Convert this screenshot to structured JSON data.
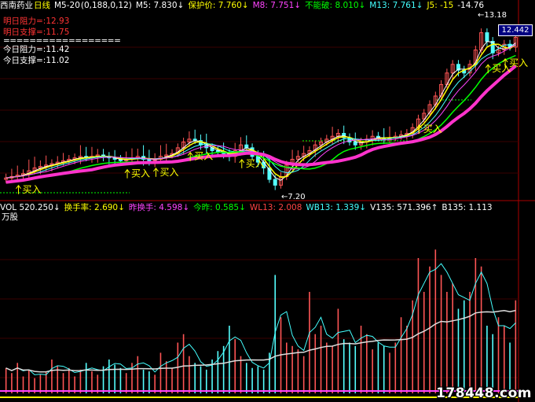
{
  "header": {
    "name": "西南药业",
    "period": "日线",
    "indicator": "M5-20",
    "params": "(0,188,0,12)",
    "items": [
      {
        "label": "M5:",
        "value": "7.830↓",
        "color": "#ffffff"
      },
      {
        "label": "保护价:",
        "value": "7.760↓",
        "color": "#ffff00"
      },
      {
        "label": "M8:",
        "value": "7.751↓",
        "color": "#ff44ff"
      },
      {
        "label": "不能破:",
        "value": "8.010↓",
        "color": "#00ff00"
      },
      {
        "label": "M13:",
        "value": "7.761↓",
        "color": "#44ffff"
      },
      {
        "label": "J5:",
        "value": "-15",
        "color": "#ffff00"
      },
      {
        "label": "",
        "value": "-14.76",
        "color": "#ffffff"
      }
    ]
  },
  "levels": {
    "tomorrow_resist": "明日阻力=:12.93",
    "tomorrow_support": "明日支撑=:11.75",
    "separator": "==================",
    "today_resist": "今日阻力=:11.42",
    "today_support": "今日支撑=:11.02"
  },
  "volume_header": {
    "items": [
      {
        "label": "VOL",
        "value": "520.250↓",
        "color": "#ffffff"
      },
      {
        "label": "换手率:",
        "value": "2.690↓",
        "color": "#ffff00"
      },
      {
        "label": "昨换手:",
        "value": "4.598↓",
        "color": "#ff44ff"
      },
      {
        "label": "今昨:",
        "value": "0.585↓",
        "color": "#00ff00"
      },
      {
        "label": "WL13:",
        "value": "2.008",
        "color": "#ff4444"
      },
      {
        "label": "WB13:",
        "value": "1.339↓",
        "color": "#44ffff"
      },
      {
        "label": "V135:",
        "value": "571.396↑",
        "color": "#ffffff"
      },
      {
        "label": "B135:",
        "value": "1.113",
        "color": "#ffffff"
      }
    ],
    "unit": "万股"
  },
  "price_tag": "12.442",
  "watermark": "178448.com",
  "chart_data": {
    "type": "candlestick",
    "high_label": "13.18",
    "low_label": "7.20",
    "buy_label": "买入",
    "buy_signals": [
      3,
      22,
      27,
      33,
      42,
      73,
      85,
      88
    ],
    "price_range": [
      6.9,
      13.3
    ],
    "volume_range": [
      0,
      100
    ],
    "n": 90,
    "prices": [
      7.55,
      7.6,
      7.65,
      7.7,
      7.8,
      7.9,
      7.95,
      8.0,
      8.05,
      8.1,
      8.15,
      8.2,
      8.25,
      8.3,
      8.25,
      8.3,
      8.35,
      8.3,
      8.25,
      8.2,
      8.15,
      8.2,
      8.25,
      8.3,
      8.2,
      8.15,
      8.2,
      8.3,
      8.35,
      8.4,
      8.6,
      8.8,
      8.9,
      8.85,
      8.7,
      8.6,
      8.5,
      8.45,
      8.4,
      8.3,
      8.5,
      8.7,
      8.6,
      8.3,
      8.1,
      7.9,
      7.5,
      7.3,
      7.6,
      8.0,
      8.2,
      8.3,
      8.4,
      8.5,
      8.7,
      8.8,
      8.9,
      9.0,
      9.1,
      8.95,
      8.8,
      8.7,
      8.8,
      8.9,
      9.0,
      8.95,
      8.9,
      8.95,
      9.0,
      9.05,
      9.1,
      9.3,
      9.6,
      9.8,
      10.1,
      10.4,
      10.8,
      11.2,
      11.5,
      11.3,
      11.2,
      11.5,
      12.0,
      12.6,
      12.3,
      11.9,
      12.0,
      12.2,
      12.1,
      12.44
    ],
    "volumes": [
      15,
      12,
      18,
      10,
      14,
      9,
      11,
      13,
      20,
      16,
      12,
      15,
      10,
      14,
      18,
      13,
      11,
      16,
      20,
      17,
      15,
      12,
      18,
      22,
      14,
      13,
      11,
      24,
      19,
      15,
      30,
      35,
      22,
      18,
      16,
      14,
      20,
      25,
      28,
      40,
      32,
      22,
      18,
      15,
      16,
      14,
      24,
      70,
      45,
      30,
      28,
      26,
      22,
      60,
      35,
      40,
      30,
      28,
      50,
      32,
      30,
      28,
      40,
      35,
      26,
      30,
      28,
      24,
      30,
      45,
      40,
      55,
      80,
      60,
      75,
      85,
      70,
      60,
      65,
      50,
      55,
      60,
      80,
      75,
      40,
      35,
      45,
      40,
      30,
      55
    ]
  }
}
